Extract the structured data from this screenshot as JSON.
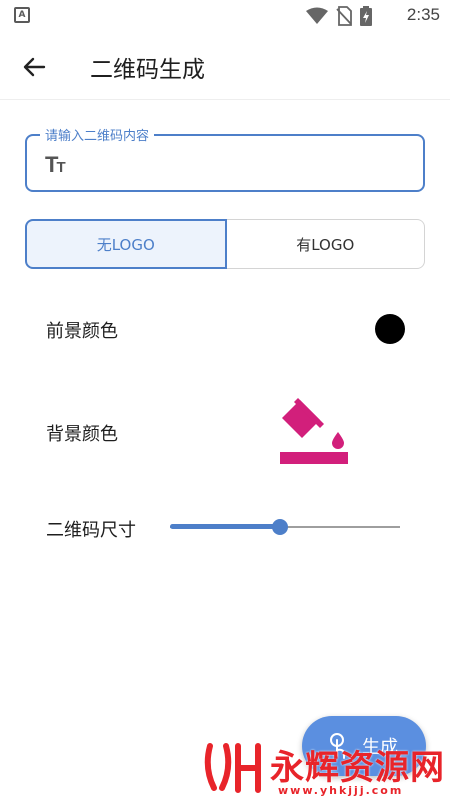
{
  "status_bar": {
    "time": "2:35",
    "app_badge": "A",
    "icons": [
      "wifi-icon",
      "no-sim-icon",
      "battery-charging-icon"
    ]
  },
  "app_bar": {
    "back_icon": "arrow-left-icon",
    "title": "二维码生成"
  },
  "input": {
    "label": "请输入二维码内容",
    "value": "",
    "icon": "text-format-icon",
    "icon_glyph": "T",
    "icon_glyph_small": "T"
  },
  "logo_toggle": {
    "options": [
      "无LOGO",
      "有LOGO"
    ],
    "selected": "无LOGO"
  },
  "foreground": {
    "label": "前景颜色",
    "color": "#000000"
  },
  "background": {
    "label": "背景颜色",
    "icon": "paint-bucket-icon",
    "color": "#d21f7b"
  },
  "size": {
    "label": "二维码尺寸",
    "value_fraction": 0.48
  },
  "fab": {
    "label": "生成",
    "icon": "touch-icon"
  },
  "watermark": {
    "title": "永辉资源网",
    "url": "www.yhkjjj.com"
  },
  "colors": {
    "accent": "#4d7fc9",
    "fab": "#5b8fe0",
    "watermark": "#e8242a"
  }
}
